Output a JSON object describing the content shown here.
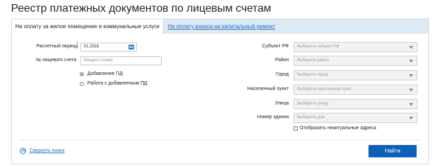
{
  "page": {
    "title": "Реестр платежных документов по лицевым счетам"
  },
  "tabs": [
    {
      "label": "На оплату за жилое помещение и коммунальные услуги",
      "active": true
    },
    {
      "label": "На оплату взноса на капитальный ремонт",
      "active": false
    }
  ],
  "left_form": {
    "period_label": "Расчетный период",
    "period_required_mark": "*",
    "period_value": "01.2018",
    "account_label": "№ лицевого счета",
    "account_placeholder": "Введите номер",
    "radio_options": [
      {
        "label": "Добавление ПД",
        "selected": true
      },
      {
        "label": "Работа с добавленным ПД",
        "selected": false
      }
    ]
  },
  "right_form": {
    "fields": [
      {
        "label": "Субъект РФ",
        "placeholder": "Выберите субъект РФ"
      },
      {
        "label": "Район",
        "placeholder": "Выберите район"
      },
      {
        "label": "Город",
        "placeholder": "Выберите город"
      },
      {
        "label": "Населенный пункт",
        "placeholder": "Выберите населенный пункт"
      },
      {
        "label": "Улица",
        "placeholder": "Выберите улицу"
      },
      {
        "label": "Номер здания",
        "placeholder": "Выберите дом"
      }
    ],
    "checkbox_label": "Отобразить неактуальные адреса",
    "checkbox_checked": false
  },
  "footer": {
    "collapse_label": "Свернуть поиск",
    "find_button": "Найти"
  },
  "colors": {
    "accent": "#1a6fc1",
    "button": "#0d5fb8",
    "tabbar": "#dde9f3"
  }
}
